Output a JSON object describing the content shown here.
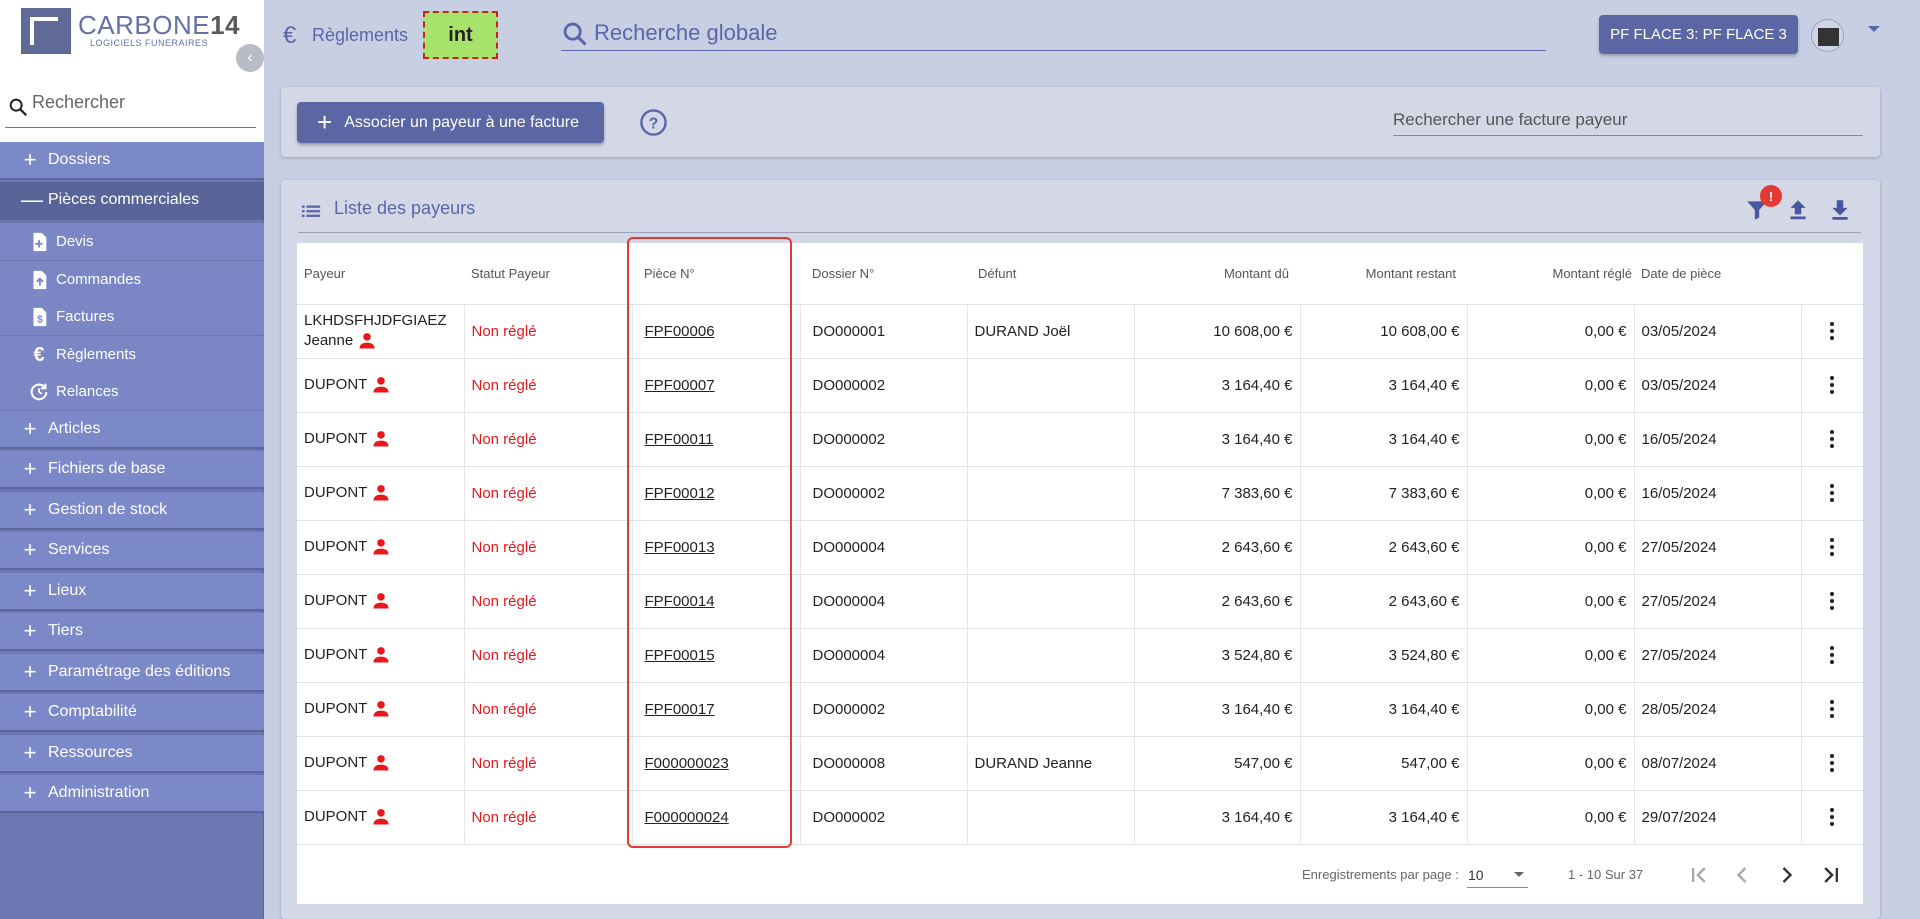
{
  "app": {
    "logo_title": "CARBONE",
    "logo_number": "14",
    "logo_subtitle": "LOGICIELS FUNERAIRES",
    "env_badge": "int",
    "accent_color": "#5b66a4",
    "sidebar_color": "#6b78b2"
  },
  "sidebar": {
    "search_placeholder": "Rechercher",
    "categories": [
      {
        "label": "Dossiers",
        "icon": "plus-icon"
      },
      {
        "label": "Pièces commerciales",
        "icon": "minus-icon",
        "open": true
      },
      {
        "label": "Articles",
        "icon": "plus-icon"
      },
      {
        "label": "Fichiers de base",
        "icon": "plus-icon"
      },
      {
        "label": "Gestion de stock",
        "icon": "plus-icon"
      },
      {
        "label": "Services",
        "icon": "plus-icon"
      },
      {
        "label": "Lieux",
        "icon": "plus-icon"
      },
      {
        "label": "Tiers",
        "icon": "plus-icon"
      },
      {
        "label": "Paramétrage des éditions",
        "icon": "plus-icon"
      },
      {
        "label": "Comptabilité",
        "icon": "plus-icon"
      },
      {
        "label": "Ressources",
        "icon": "plus-icon"
      },
      {
        "label": "Administration",
        "icon": "plus-icon"
      }
    ],
    "subitems": [
      {
        "label": "Devis",
        "icon": "document-add-icon"
      },
      {
        "label": "Commandes",
        "icon": "document-upload-icon"
      },
      {
        "label": "Factures",
        "icon": "document-dollar-icon"
      },
      {
        "label": "Règlements",
        "icon": "euro-icon"
      },
      {
        "label": "Relances",
        "icon": "refresh-clock-icon"
      }
    ]
  },
  "topbar": {
    "breadcrumb": "Règlements",
    "breadcrumb_icon": "euro-icon",
    "search_placeholder": "Recherche globale",
    "site_button": "PF FLACE 3: PF FLACE 3"
  },
  "actions": {
    "associate_button": "Associer un payeur à une facture",
    "invoice_search_placeholder": "Rechercher une facture payeur"
  },
  "list": {
    "title": "Liste des payeurs",
    "filter_badge": "!",
    "columns": [
      "Payeur",
      "Statut Payeur",
      "Pièce N°",
      "Dossier N°",
      "Défunt",
      "Montant dû",
      "Montant restant",
      "Montant réglé",
      "Date de pièce"
    ],
    "rows": [
      {
        "payeur": "LKHDSFHJDFGIAEZ Jeanne",
        "statut": "Non réglé",
        "piece": "FPF00006",
        "dossier": "DO000001",
        "defunt": "DURAND Joël",
        "du": "10 608,00 €",
        "restant": "10 608,00 €",
        "regle": "0,00 €",
        "date": "03/05/2024"
      },
      {
        "payeur": "DUPONT",
        "statut": "Non réglé",
        "piece": "FPF00007",
        "dossier": "DO000002",
        "defunt": "",
        "du": "3 164,40 €",
        "restant": "3 164,40 €",
        "regle": "0,00 €",
        "date": "03/05/2024"
      },
      {
        "payeur": "DUPONT",
        "statut": "Non réglé",
        "piece": "FPF00011",
        "dossier": "DO000002",
        "defunt": "",
        "du": "3 164,40 €",
        "restant": "3 164,40 €",
        "regle": "0,00 €",
        "date": "16/05/2024"
      },
      {
        "payeur": "DUPONT",
        "statut": "Non réglé",
        "piece": "FPF00012",
        "dossier": "DO000002",
        "defunt": "",
        "du": "7 383,60 €",
        "restant": "7 383,60 €",
        "regle": "0,00 €",
        "date": "16/05/2024"
      },
      {
        "payeur": "DUPONT",
        "statut": "Non réglé",
        "piece": "FPF00013",
        "dossier": "DO000004",
        "defunt": "",
        "du": "2 643,60 €",
        "restant": "2 643,60 €",
        "regle": "0,00 €",
        "date": "27/05/2024"
      },
      {
        "payeur": "DUPONT",
        "statut": "Non réglé",
        "piece": "FPF00014",
        "dossier": "DO000004",
        "defunt": "",
        "du": "2 643,60 €",
        "restant": "2 643,60 €",
        "regle": "0,00 €",
        "date": "27/05/2024"
      },
      {
        "payeur": "DUPONT",
        "statut": "Non réglé",
        "piece": "FPF00015",
        "dossier": "DO000004",
        "defunt": "",
        "du": "3 524,80 €",
        "restant": "3 524,80 €",
        "regle": "0,00 €",
        "date": "27/05/2024"
      },
      {
        "payeur": "DUPONT",
        "statut": "Non réglé",
        "piece": "FPF00017",
        "dossier": "DO000002",
        "defunt": "",
        "du": "3 164,40 €",
        "restant": "3 164,40 €",
        "regle": "0,00 €",
        "date": "28/05/2024"
      },
      {
        "payeur": "DUPONT",
        "statut": "Non réglé",
        "piece": "F000000023",
        "dossier": "DO000008",
        "defunt": "DURAND Jeanne",
        "du": "547,00 €",
        "restant": "547,00 €",
        "regle": "0,00 €",
        "date": "08/07/2024"
      },
      {
        "payeur": "DUPONT",
        "statut": "Non réglé",
        "piece": "F000000024",
        "dossier": "DO000002",
        "defunt": "",
        "du": "3 164,40 €",
        "restant": "3 164,40 €",
        "regle": "0,00 €",
        "date": "29/07/2024"
      }
    ],
    "status_color": "#e8171c",
    "highlight_color": "#e53935"
  },
  "pagination": {
    "per_page_label": "Enregistrements par page :",
    "per_page_value": "10",
    "range": "1 - 10 Sur 37"
  }
}
